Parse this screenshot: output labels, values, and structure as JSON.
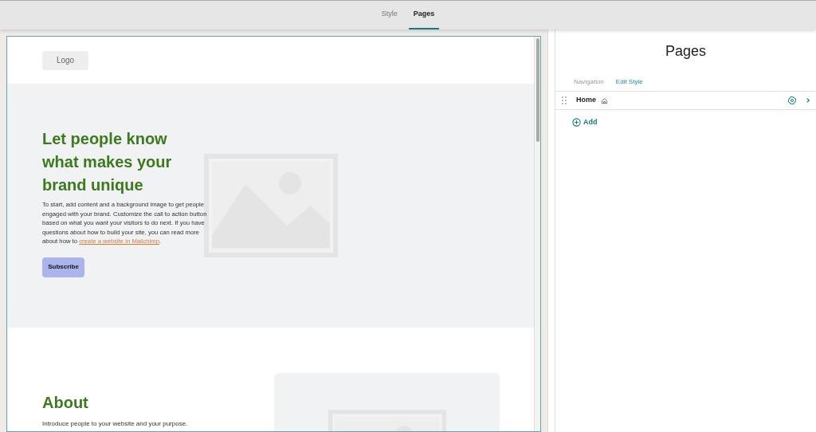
{
  "top_tabs": [
    {
      "label": "Style",
      "selected": false
    },
    {
      "label": "Pages",
      "selected": true
    }
  ],
  "preview": {
    "logo": "Logo",
    "hero": {
      "heading": "Let people know what makes your brand unique",
      "text": "To start, add content and a background image to get people engaged with your brand. Customize the call to action button based on what you want your visitors to do next. If you have questions about how to build your site, you can read more about how to ",
      "link": "create a website in Mailchimp",
      "text_end": ".",
      "button": "Subscribe"
    },
    "about": {
      "heading": "About",
      "text": "Introduce people to your website and your purpose."
    }
  },
  "panel": {
    "title": "Pages",
    "links": [
      "Navigation",
      "Edit Style"
    ],
    "pages": [
      {
        "label": "Home"
      }
    ],
    "add": "Add"
  }
}
